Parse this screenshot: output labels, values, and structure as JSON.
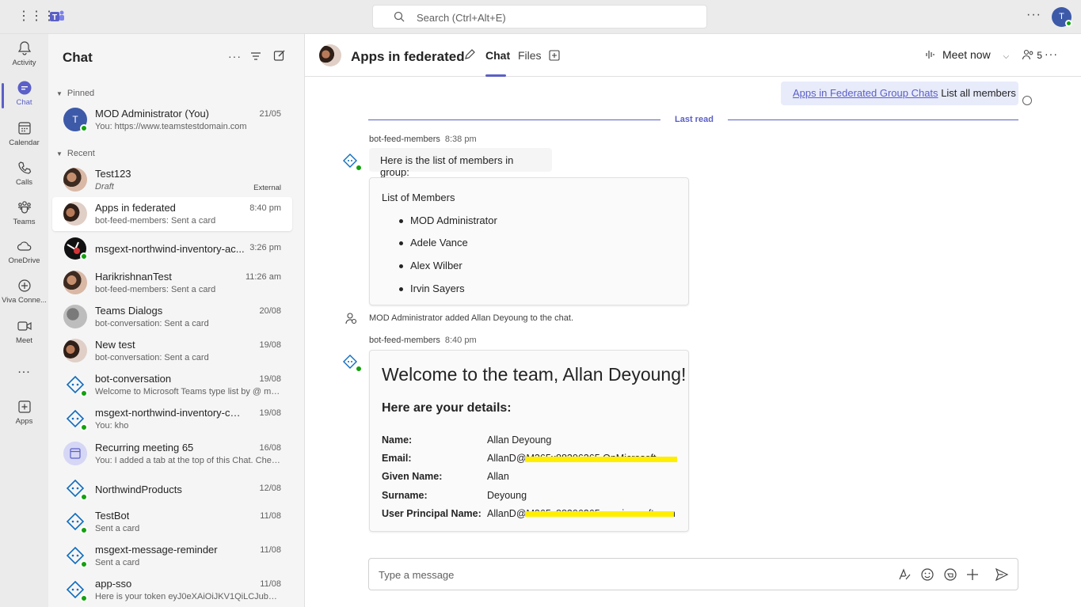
{
  "topbar": {
    "search_placeholder": "Search (Ctrl+Alt+E)",
    "user_initials": "T"
  },
  "rail": {
    "items": [
      {
        "label": "Activity",
        "icon": "bell-icon"
      },
      {
        "label": "Chat",
        "icon": "chat-icon"
      },
      {
        "label": "Calendar",
        "icon": "calendar-icon"
      },
      {
        "label": "Calls",
        "icon": "phone-icon"
      },
      {
        "label": "Teams",
        "icon": "teams-icon"
      },
      {
        "label": "OneDrive",
        "icon": "cloud-icon"
      },
      {
        "label": "Viva Conne...",
        "icon": "viva-icon"
      },
      {
        "label": "Meet",
        "icon": "video-icon"
      },
      {
        "label": "Apps",
        "icon": "apps-icon"
      }
    ],
    "more": "..."
  },
  "chatlist": {
    "title": "Chat",
    "pinned_label": "Pinned",
    "recent_label": "Recent",
    "pinned": [
      {
        "name": "MOD Administrator (You)",
        "preview": "You: https://www.teamstestdomain.com",
        "time": "21/05",
        "initials": "T"
      }
    ],
    "recent": [
      {
        "name": "Test123",
        "preview": "Draft",
        "time": "",
        "extra": "External"
      },
      {
        "name": "Apps in federated",
        "preview": "bot-feed-members: Sent a card",
        "time": "8:40 pm"
      },
      {
        "name": "msgext-northwind-inventory-ac...",
        "preview": "",
        "time": "3:26 pm"
      },
      {
        "name": "HarikrishnanTest",
        "preview": "bot-feed-members: Sent a card",
        "time": "11:26 am"
      },
      {
        "name": "Teams Dialogs",
        "preview": "bot-conversation: Sent a card",
        "time": "20/08"
      },
      {
        "name": "New test",
        "preview": "bot-conversation: Sent a card",
        "time": "19/08"
      },
      {
        "name": "bot-conversation",
        "preview": "Welcome to Microsoft Teams type list by @ me...",
        "time": "19/08"
      },
      {
        "name": "msgext-northwind-inventory-csha...",
        "preview": "You: kho",
        "time": "19/08"
      },
      {
        "name": "Recurring meeting 65",
        "preview": "You: I added a tab at the top of this Chat. Chec...",
        "time": "16/08"
      },
      {
        "name": "NorthwindProducts",
        "preview": "",
        "time": "12/08"
      },
      {
        "name": "TestBot",
        "preview": "Sent a card",
        "time": "11/08"
      },
      {
        "name": "msgext-message-reminder",
        "preview": "Sent a card",
        "time": "11/08"
      },
      {
        "name": "app-sso",
        "preview": "Here is your token eyJ0eXAiOiJKV1QiLCJub25jZ...",
        "time": "11/08"
      }
    ]
  },
  "header": {
    "chat_name": "Apps in federated",
    "tabs": [
      "Chat",
      "Files"
    ],
    "meet_now": "Meet now",
    "participants": "5"
  },
  "messages": {
    "my_link": "Apps in Federated Group Chats",
    "my_text": "List all members",
    "last_read": "Last read",
    "msg1_sender": "bot-feed-members",
    "msg1_time": "8:38 pm",
    "msg1_text": "Here is the list of members in group:",
    "list_title": "List of Members",
    "members": [
      "MOD Administrator",
      "Adele Vance",
      "Alex Wilber",
      "Irvin Sayers"
    ],
    "system_text": "MOD Administrator added Allan Deyoung to the chat.",
    "msg2_sender": "bot-feed-members",
    "msg2_time": "8:40 pm",
    "welcome": "Welcome to the team, Allan Deyoung!",
    "details_heading": "Here are your details:",
    "details": [
      {
        "key": "Name:",
        "value": "Allan Deyoung"
      },
      {
        "key": "Email:",
        "value": "AllanD@M365x88306265.OnMicrosoft"
      },
      {
        "key": "Given Name:",
        "value": "Allan"
      },
      {
        "key": "Surname:",
        "value": "Deyoung"
      },
      {
        "key": "User Principal Name:",
        "value": "AllanD@M365x88306265.onmicrosoft.com"
      }
    ]
  },
  "compose": {
    "placeholder": "Type a message"
  },
  "colors": {
    "accent": "#5b5fc7",
    "presence": "#13a10e",
    "redaction": "#ffee00"
  }
}
